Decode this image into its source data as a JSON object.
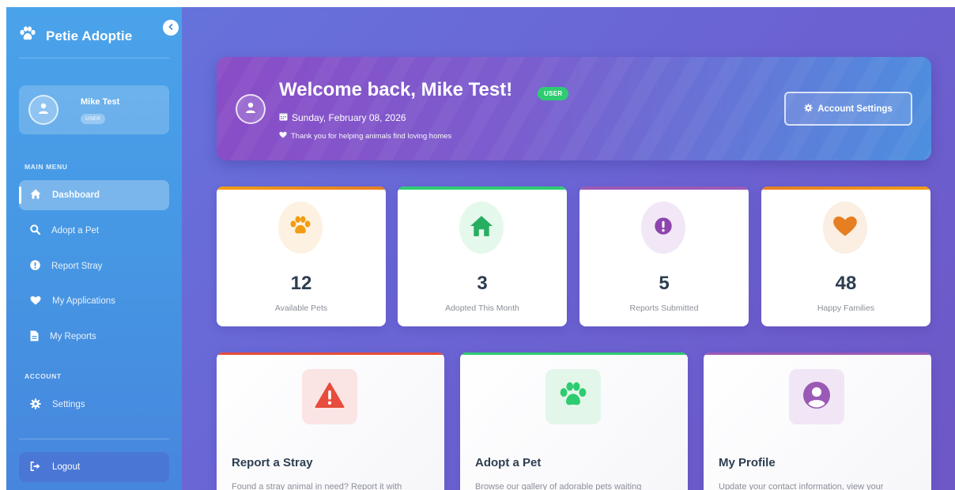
{
  "sidebar": {
    "brand": "Petie Adoptie",
    "user": {
      "name": "Mike Test",
      "role": "USER"
    },
    "main_menu_label": "MAIN MENU",
    "items": [
      {
        "label": "Dashboard",
        "icon": "home-icon",
        "active": true
      },
      {
        "label": "Adopt a Pet",
        "icon": "search-icon"
      },
      {
        "label": "Report Stray",
        "icon": "exclamation-icon"
      },
      {
        "label": "My Applications",
        "icon": "heart-icon"
      },
      {
        "label": "My Reports",
        "icon": "document-icon"
      }
    ],
    "account_label": "ACCOUNT",
    "settings_label": "Settings",
    "logout_label": "Logout"
  },
  "welcome": {
    "title": "Welcome back, Mike Test!",
    "badge": "USER",
    "date": "Sunday, February 08, 2026",
    "note": "Thank you for helping animals find loving homes",
    "account_button": "Account Settings"
  },
  "stats": [
    {
      "value": "12",
      "label": "Available Pets",
      "color": "#f39c12",
      "icon": "paw-icon"
    },
    {
      "value": "3",
      "label": "Adopted This Month",
      "color": "#2ecc71",
      "icon": "home-icon"
    },
    {
      "value": "5",
      "label": "Reports Submitted",
      "color": "#9b59b6",
      "icon": "exclamation-icon"
    },
    {
      "value": "48",
      "label": "Happy Families",
      "color": "#e67e22",
      "icon": "heart-icon"
    }
  ],
  "actions": [
    {
      "title": "Report a Stray",
      "desc": "Found a stray animal in need? Report it with",
      "color": "#e74c3c",
      "icon": "warning-icon"
    },
    {
      "title": "Adopt a Pet",
      "desc": "Browse our gallery of adorable pets waiting",
      "color": "#2ecc71",
      "icon": "paw-icon"
    },
    {
      "title": "My Profile",
      "desc": "Update your contact information, view your",
      "color": "#9b59b6",
      "icon": "user-circle-icon"
    }
  ],
  "colors": {
    "sidebar": "#4697e4",
    "accent_green": "#2ecc71",
    "text_dark": "#2c3e50"
  }
}
